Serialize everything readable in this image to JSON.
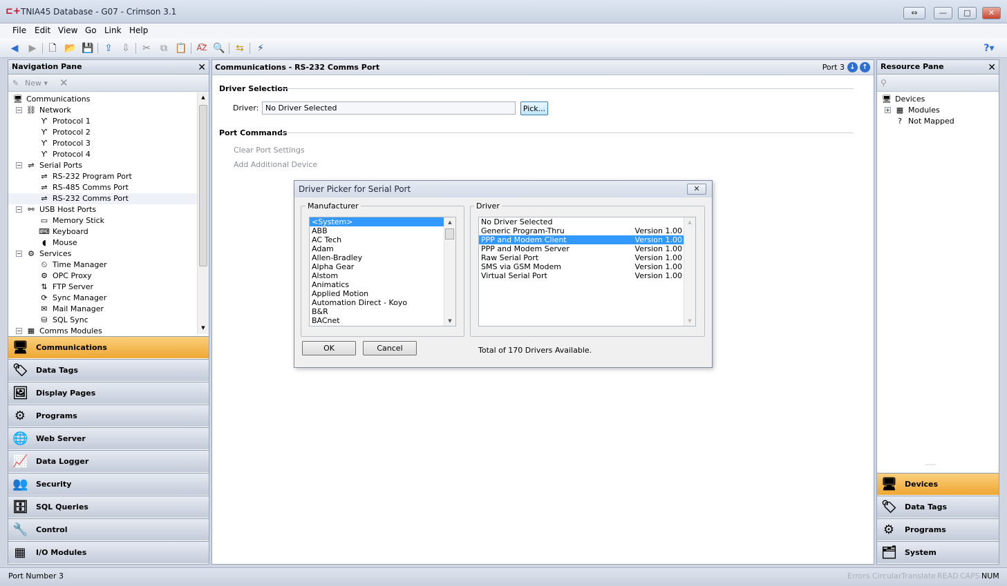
{
  "window": {
    "title": "TNIA45 Database - G07 - Crimson 3.1",
    "controls": {
      "restore_extra": "⇔",
      "minimize": "—",
      "maximize": "□",
      "close": "✕"
    }
  },
  "menu": [
    "File",
    "Edit",
    "View",
    "Go",
    "Link",
    "Help"
  ],
  "nav_pane": {
    "title": "Navigation Pane",
    "new_label": "New ▾",
    "tree": [
      {
        "label": "Communications",
        "level": 0,
        "icon": "computer-icon"
      },
      {
        "label": "Network",
        "level": 1,
        "icon": "network-icon",
        "exp": "−"
      },
      {
        "label": "Protocol 1",
        "level": 2,
        "icon": "protocol-icon"
      },
      {
        "label": "Protocol 2",
        "level": 2,
        "icon": "protocol-icon"
      },
      {
        "label": "Protocol 3",
        "level": 2,
        "icon": "protocol-icon"
      },
      {
        "label": "Protocol 4",
        "level": 2,
        "icon": "protocol-icon"
      },
      {
        "label": "Serial Ports",
        "level": 1,
        "icon": "serial-icon",
        "exp": "−"
      },
      {
        "label": "RS-232 Program Port",
        "level": 2,
        "icon": "port-icon"
      },
      {
        "label": "RS-485 Comms Port",
        "level": 2,
        "icon": "port-icon"
      },
      {
        "label": "RS-232 Comms Port",
        "level": 2,
        "icon": "port-icon",
        "selected": true
      },
      {
        "label": "USB Host Ports",
        "level": 1,
        "icon": "usb-icon",
        "exp": "−"
      },
      {
        "label": "Memory Stick",
        "level": 2,
        "icon": "memory-stick-icon"
      },
      {
        "label": "Keyboard",
        "level": 2,
        "icon": "keyboard-icon"
      },
      {
        "label": "Mouse",
        "level": 2,
        "icon": "mouse-icon"
      },
      {
        "label": "Services",
        "level": 1,
        "icon": "services-icon",
        "exp": "−"
      },
      {
        "label": "Time Manager",
        "level": 2,
        "icon": "time-icon"
      },
      {
        "label": "OPC Proxy",
        "level": 2,
        "icon": "opc-icon"
      },
      {
        "label": "FTP Server",
        "level": 2,
        "icon": "ftp-icon"
      },
      {
        "label": "Sync Manager",
        "level": 2,
        "icon": "sync-icon"
      },
      {
        "label": "Mail Manager",
        "level": 2,
        "icon": "mail-icon"
      },
      {
        "label": "SQL Sync",
        "level": 2,
        "icon": "sql-icon"
      },
      {
        "label": "Comms Modules",
        "level": 1,
        "icon": "modules-icon",
        "exp": "−"
      }
    ],
    "categories": [
      {
        "label": "Communications",
        "icon": "🖥",
        "active": true
      },
      {
        "label": "Data Tags",
        "icon": "🏷"
      },
      {
        "label": "Display Pages",
        "icon": "🖼"
      },
      {
        "label": "Programs",
        "icon": "⚙"
      },
      {
        "label": "Web Server",
        "icon": "🌐"
      },
      {
        "label": "Data Logger",
        "icon": "📈"
      },
      {
        "label": "Security",
        "icon": "👥"
      },
      {
        "label": "SQL Queries",
        "icon": "🗄"
      },
      {
        "label": "Control",
        "icon": "🔧"
      },
      {
        "label": "I/O Modules",
        "icon": "▦"
      }
    ]
  },
  "main": {
    "header": "Communications - RS-232 Comms Port",
    "port_label": "Port 3",
    "driver_section": "Driver Selection",
    "driver_label": "Driver:",
    "driver_value": "No Driver Selected",
    "pick_button": "Pick...",
    "port_commands": "Port Commands",
    "clear_settings": "Clear Port Settings",
    "add_device": "Add Additional Device"
  },
  "dialog": {
    "title": "Driver Picker for Serial Port",
    "manufacturer_label": "Manufacturer",
    "driver_label": "Driver",
    "manufacturers": [
      "<System>",
      "ABB",
      "AC Tech",
      "Adam",
      "Allen-Bradley",
      "Alpha Gear",
      "Alstom",
      "Animatics",
      "Applied Motion",
      "Automation Direct - Koyo",
      "B&R",
      "BACnet"
    ],
    "selected_manufacturer": 0,
    "drivers": [
      {
        "name": "No Driver Selected",
        "version": ""
      },
      {
        "name": "Generic Program-Thru",
        "version": "Version 1.00"
      },
      {
        "name": "PPP and Modem Client",
        "version": "Version 1.00"
      },
      {
        "name": "PPP and Modem Server",
        "version": "Version 1.00"
      },
      {
        "name": "Raw Serial Port",
        "version": "Version 1.00"
      },
      {
        "name": "SMS via GSM Modem",
        "version": "Version 1.00"
      },
      {
        "name": "Virtual Serial Port",
        "version": "Version 1.00"
      }
    ],
    "selected_driver": 2,
    "ok": "OK",
    "cancel": "Cancel",
    "total": "Total of 170 Drivers Available."
  },
  "resource_pane": {
    "title": "Resource Pane",
    "tree": [
      {
        "label": "Devices",
        "level": 0,
        "icon": "devices-icon"
      },
      {
        "label": "Modules",
        "level": 1,
        "icon": "modules-icon",
        "exp": "+"
      },
      {
        "label": "Not Mapped",
        "level": 1,
        "icon": "not-mapped-icon"
      }
    ],
    "categories": [
      {
        "label": "Devices",
        "icon": "🖥",
        "active": true
      },
      {
        "label": "Data Tags",
        "icon": "🏷"
      },
      {
        "label": "Programs",
        "icon": "⚙"
      },
      {
        "label": "System",
        "icon": "🗂"
      }
    ]
  },
  "status": {
    "left": "Port Number 3",
    "indicators": [
      "Errors",
      "Circular",
      "Translate",
      "READ",
      "CAPS",
      "NUM"
    ]
  }
}
